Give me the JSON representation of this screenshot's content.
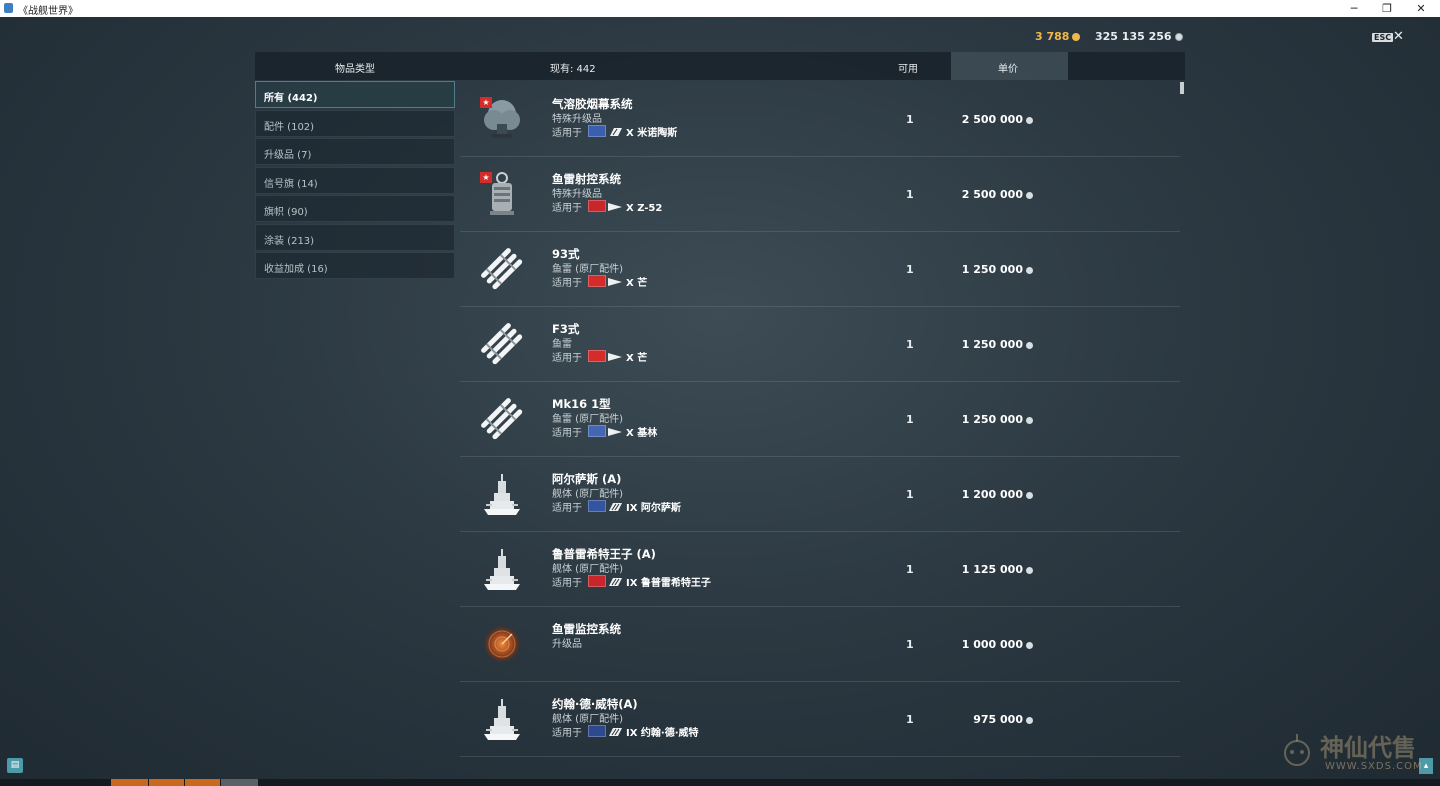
{
  "window": {
    "title": "《战舰世界》",
    "minimize": "─",
    "restore": "❐",
    "close": "✕"
  },
  "currency": {
    "gold": "3 788",
    "credits": "325 135 256"
  },
  "esc": {
    "label": "ESC",
    "close": "✕"
  },
  "header": {
    "category": "物品类型",
    "owned": "现有: 442",
    "available": "可用",
    "price": "单价"
  },
  "categories": [
    {
      "label": "所有 (442)"
    },
    {
      "label": "配件 (102)"
    },
    {
      "label": "升级品 (7)"
    },
    {
      "label": "信号旗 (14)"
    },
    {
      "label": "旗帜 (90)"
    },
    {
      "label": "涂装 (213)"
    },
    {
      "label": "收益加成 (16)"
    }
  ],
  "items": [
    {
      "name": "气溶胶烟幕系统",
      "type": "特殊升级品",
      "for_label": "适用于",
      "ship": "X 米诺陶斯",
      "qty": "1",
      "price": "2 500 000",
      "icon": "smoke-module-icon",
      "flag": "uk-flag-icon",
      "class": "cruiser-class-icon",
      "flag_color": "#3a5fb0"
    },
    {
      "name": "鱼雷射控系统",
      "type": "特殊升级品",
      "for_label": "适用于",
      "ship": "X Z-52",
      "qty": "1",
      "price": "2 500 000",
      "icon": "torpedo-director-icon",
      "flag": "germany-flag-icon",
      "class": "destroyer-class-icon",
      "flag_color": "#c8262b"
    },
    {
      "name": "93式",
      "type": "鱼雷 (原厂配件)",
      "for_label": "适用于",
      "ship": "X 芒",
      "qty": "1",
      "price": "1 250 000",
      "icon": "torpedo-launcher-icon",
      "flag": "japan-flag-icon",
      "class": "destroyer-class-icon",
      "flag_color": "#d42b2b"
    },
    {
      "name": "F3式",
      "type": "鱼雷",
      "for_label": "适用于",
      "ship": "X 芒",
      "qty": "1",
      "price": "1 250 000",
      "icon": "torpedo-launcher-icon",
      "flag": "japan-flag-icon",
      "class": "destroyer-class-icon",
      "flag_color": "#d42b2b"
    },
    {
      "name": "Mk16 1型",
      "type": "鱼雷 (原厂配件)",
      "for_label": "适用于",
      "ship": "X 基林",
      "qty": "1",
      "price": "1 250 000",
      "icon": "torpedo-launcher-icon",
      "flag": "usa-flag-icon",
      "class": "destroyer-class-icon",
      "flag_color": "#4466b3"
    },
    {
      "name": "阿尔萨斯 (A)",
      "type": "舰体 (原厂配件)",
      "for_label": "适用于",
      "ship": "IX 阿尔萨斯",
      "qty": "1",
      "price": "1 200 000",
      "icon": "battleship-hull-icon",
      "flag": "france-flag-icon",
      "class": "battleship-class-icon",
      "flag_color": "#3355a0"
    },
    {
      "name": "鲁普雷希特王子 (A)",
      "type": "舰体 (原厂配件)",
      "for_label": "适用于",
      "ship": "IX 鲁普雷希特王子",
      "qty": "1",
      "price": "1 125 000",
      "icon": "battleship-hull-icon",
      "flag": "germany-flag-icon",
      "class": "battleship-class-icon",
      "flag_color": "#c8262b"
    },
    {
      "name": "鱼雷监控系统",
      "type": "升级品",
      "for_label": "",
      "ship": "",
      "qty": "1",
      "price": "1 000 000",
      "icon": "torpedo-radar-icon",
      "flag": "",
      "class": "",
      "flag_color": ""
    },
    {
      "name": "约翰·德·威特(A)",
      "type": "舰体 (原厂配件)",
      "for_label": "适用于",
      "ship": "IX 约翰·德·威特",
      "qty": "1",
      "price": "975 000",
      "icon": "battleship-hull-icon",
      "flag": "netherlands-flag-icon",
      "class": "battleship-class-icon",
      "flag_color": "#2e4a8f"
    }
  ],
  "watermark": {
    "text": "神仙代售",
    "url": "WWW.SXDS.COM"
  }
}
